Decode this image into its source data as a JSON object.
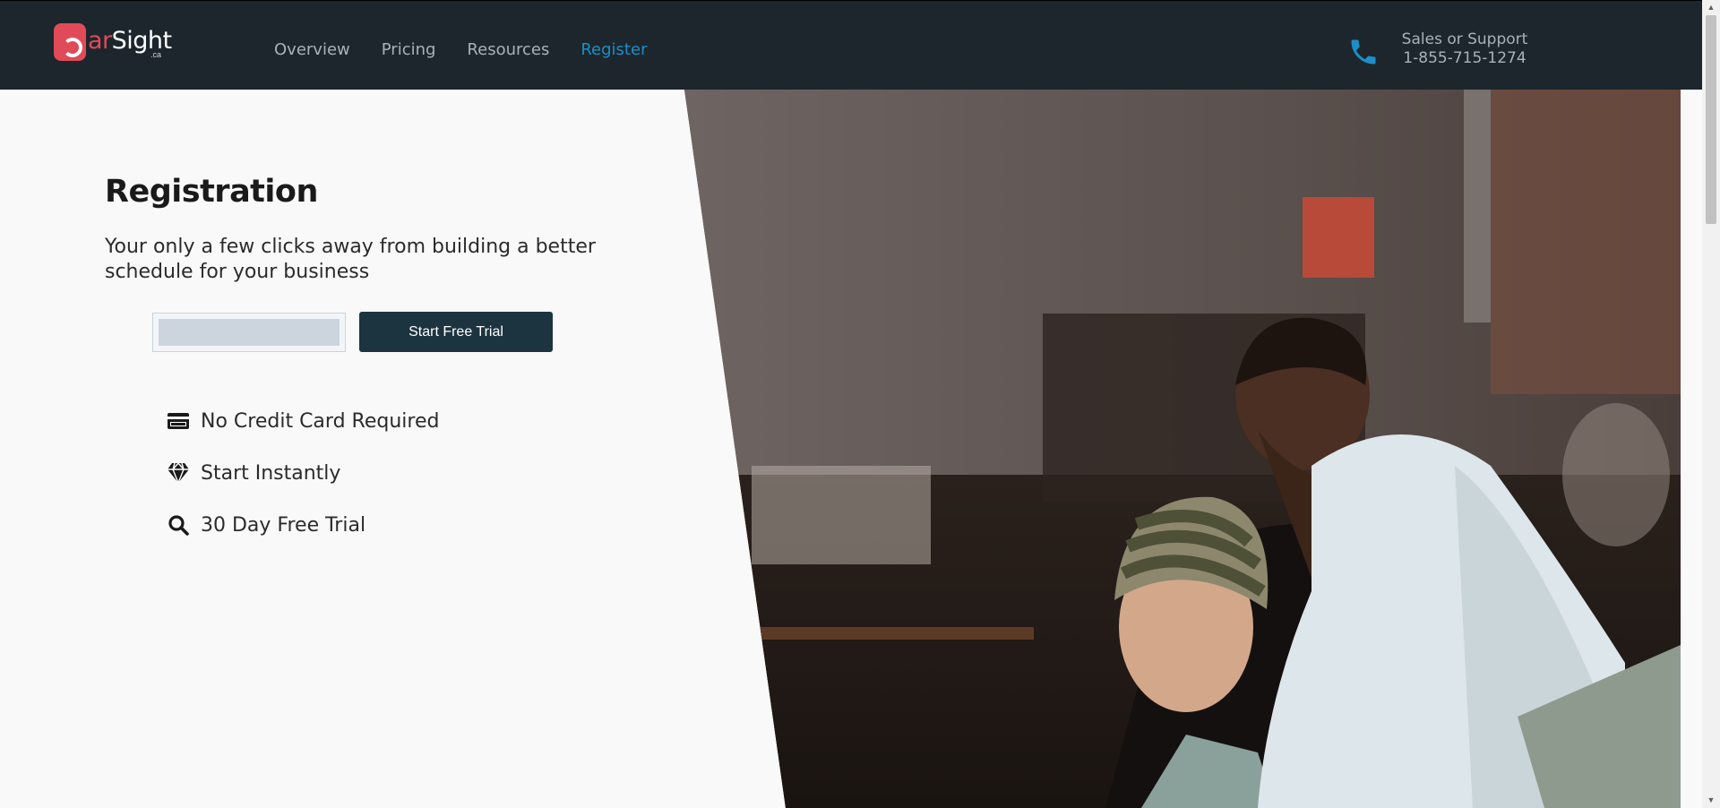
{
  "header": {
    "logo": {
      "part1": "b",
      "part2": "ar",
      "part3": "Sight",
      "tld": ".ca"
    },
    "nav": [
      "Overview",
      "Pricing",
      "Resources",
      "Register"
    ],
    "active_nav": "Register",
    "support_label": "Sales or Support",
    "support_phone": "1-855-715-1274"
  },
  "main": {
    "title": "Registration",
    "subtitle": "Your only a few clicks away from building a better schedule for your business",
    "email_placeholder": "",
    "cta_label": "Start Free Trial",
    "features": [
      {
        "icon": "credit-card-icon",
        "label": "No Credit Card Required"
      },
      {
        "icon": "diamond-icon",
        "label": "Start Instantly"
      },
      {
        "icon": "search-icon",
        "label": "30 Day Free Trial"
      }
    ]
  },
  "colors": {
    "header_bg": "#1c262c",
    "brand_red": "#e14a59",
    "nav_active": "#1e8ec7",
    "button_bg": "#1c3440",
    "page_bg": "#f9f9f9"
  }
}
